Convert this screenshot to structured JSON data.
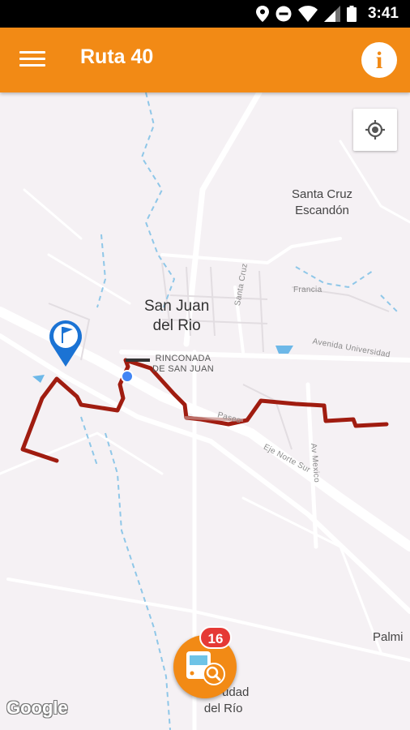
{
  "status_bar": {
    "time": "3:41",
    "icons": [
      "location-icon",
      "do-not-disturb-icon",
      "wifi-icon",
      "signal-icon",
      "battery-icon"
    ]
  },
  "app_bar": {
    "title": "Ruta 40",
    "menu_icon": "hamburger-menu-icon",
    "info_icon": "info-icon",
    "info_glyph": "i",
    "color": "#f28a15"
  },
  "map": {
    "labels": {
      "santa_cruz_escandon_line1": "Santa Cruz",
      "santa_cruz_escandon_line2": "Escandón",
      "san_juan_line1": "San Juan",
      "san_juan_line2": "del Rio",
      "rinconada_line1": "RINCONADA",
      "rinconada_line2": "DE SAN JUAN",
      "francia": "Francia",
      "santa_cruz_street": "Santa Cruz",
      "avenida_universidad": "Avenida Universidad",
      "eje_norte_sur": "Eje Norte Sur",
      "av_mexico": "Av Mexico",
      "paseo": "Paseo",
      "palmillas": "Palmi",
      "ciudad_line1": "udad",
      "ciudad_line2": "del Río"
    },
    "route_color": "#a01c10",
    "locate_icon": "my-location-icon",
    "start_marker_icon": "flag-marker-icon",
    "attribution": "Google"
  },
  "bus_fab": {
    "icon": "bus-search-icon",
    "badge_count": "16",
    "badge_color": "#e53935"
  }
}
